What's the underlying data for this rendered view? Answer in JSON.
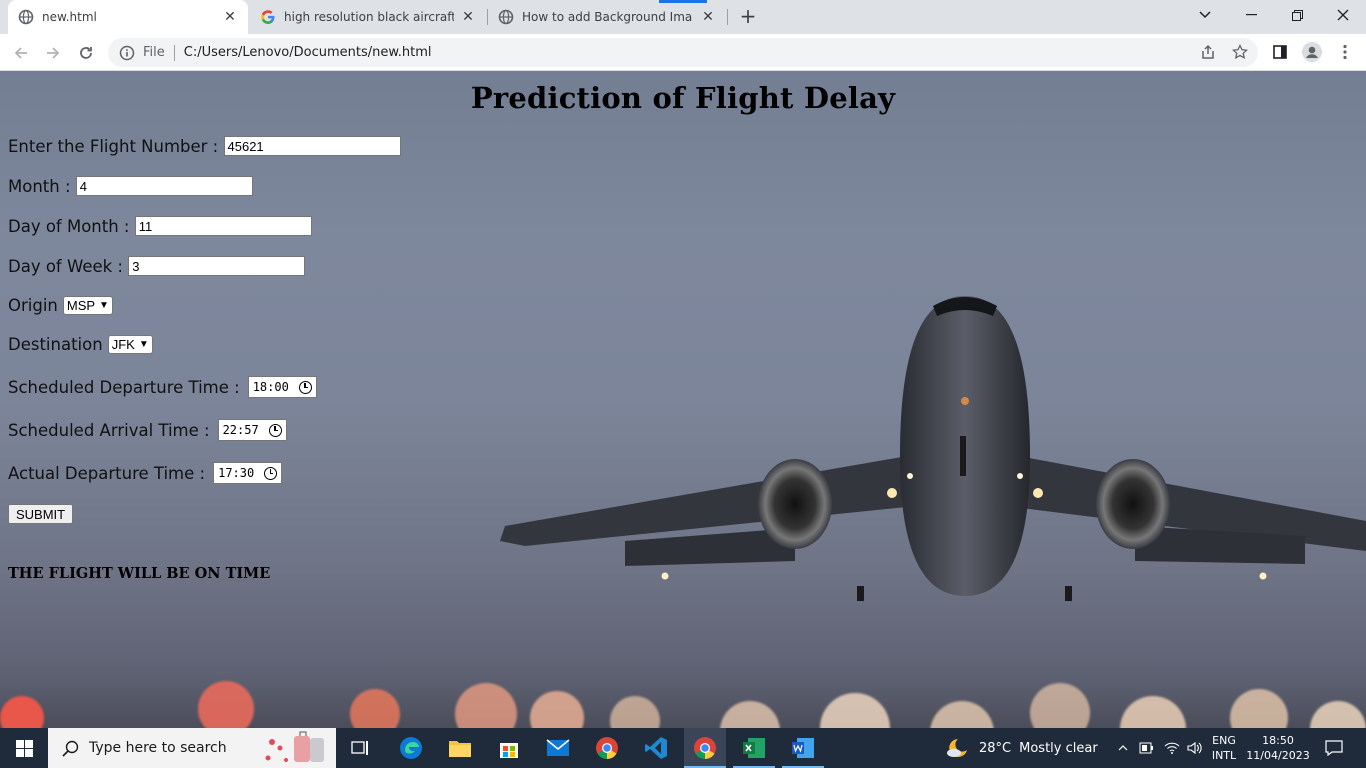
{
  "browser": {
    "tabs": [
      {
        "title": "new.html",
        "active": true,
        "icon": "globe-icon"
      },
      {
        "title": "high resolution black aircraft wall",
        "active": false,
        "icon": "google-icon"
      },
      {
        "title": "How to add Background Image in",
        "active": false,
        "icon": "globe-icon"
      }
    ],
    "address": {
      "scheme_label": "File",
      "url": "C:/Users/Lenovo/Documents/new.html"
    }
  },
  "page": {
    "title": "Prediction of Flight Delay",
    "fields": {
      "flight_number": {
        "label": "Enter the Flight Number : ",
        "value": "45621"
      },
      "month": {
        "label": "Month : ",
        "value": "4"
      },
      "day_of_month": {
        "label": "Day of Month : ",
        "value": "11"
      },
      "day_of_week": {
        "label": "Day of Week : ",
        "value": "3"
      },
      "origin": {
        "label": "Origin",
        "value": "MSP"
      },
      "destination": {
        "label": "Destination",
        "value": "JFK"
      },
      "scheduled_departure": {
        "label": "Scheduled Departure Time :",
        "value": "18:00"
      },
      "scheduled_arrival": {
        "label": "Scheduled Arrival Time :",
        "value": "22:57"
      },
      "actual_departure": {
        "label": "Actual Departure Time :",
        "value": "17:30"
      }
    },
    "submit_label": "SUBMIT",
    "result": "THE FLIGHT WILL BE ON TIME"
  },
  "taskbar": {
    "search_placeholder": "Type here to search",
    "weather_temp": "28°C",
    "weather_text": "Mostly clear",
    "lang_top": "ENG",
    "lang_bottom": "INTL",
    "time": "18:50",
    "date": "11/04/2023"
  }
}
